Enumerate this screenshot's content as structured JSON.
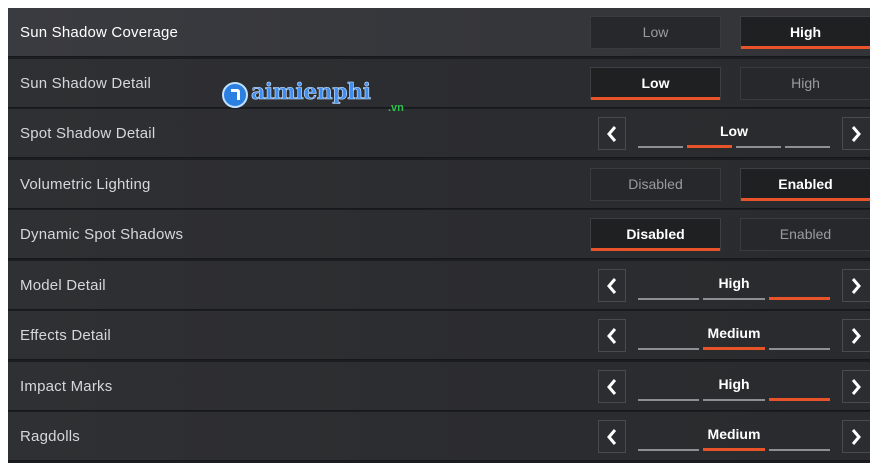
{
  "settings": [
    {
      "label": "Sun Shadow Coverage",
      "control": "toggle",
      "options": [
        "Low",
        "High"
      ],
      "selected": 1
    },
    {
      "label": "Sun Shadow Detail",
      "control": "toggle",
      "options": [
        "Low",
        "High"
      ],
      "selected": 0
    },
    {
      "label": "Spot Shadow Detail",
      "control": "carousel",
      "value": "Low",
      "segments": 4,
      "active_segment": 1
    },
    {
      "label": "Volumetric Lighting",
      "control": "toggle",
      "options": [
        "Disabled",
        "Enabled"
      ],
      "selected": 1
    },
    {
      "label": "Dynamic Spot Shadows",
      "control": "toggle",
      "options": [
        "Disabled",
        "Enabled"
      ],
      "selected": 0
    },
    {
      "label": "Model Detail",
      "control": "carousel",
      "value": "High",
      "segments": 3,
      "active_segment": 2
    },
    {
      "label": "Effects Detail",
      "control": "carousel",
      "value": "Medium",
      "segments": 3,
      "active_segment": 1
    },
    {
      "label": "Impact Marks",
      "control": "carousel",
      "value": "High",
      "segments": 3,
      "active_segment": 2
    },
    {
      "label": "Ragdolls",
      "control": "carousel",
      "value": "Medium",
      "segments": 3,
      "active_segment": 1
    }
  ],
  "highlighted_row": 0,
  "watermark": {
    "brand": "aimienphi",
    "tld": ".vn"
  },
  "colors": {
    "accent": "#e8532a",
    "row_bg": "#2d2e31",
    "highlight_bg": "#38393d",
    "text": "#d6d7da",
    "logo_blue": "#3f8ef0",
    "logo_green": "#2fc24a"
  },
  "icons": {
    "prev": "chevron-left-icon",
    "next": "chevron-right-icon",
    "logo": "taimienphi-logo-icon"
  }
}
